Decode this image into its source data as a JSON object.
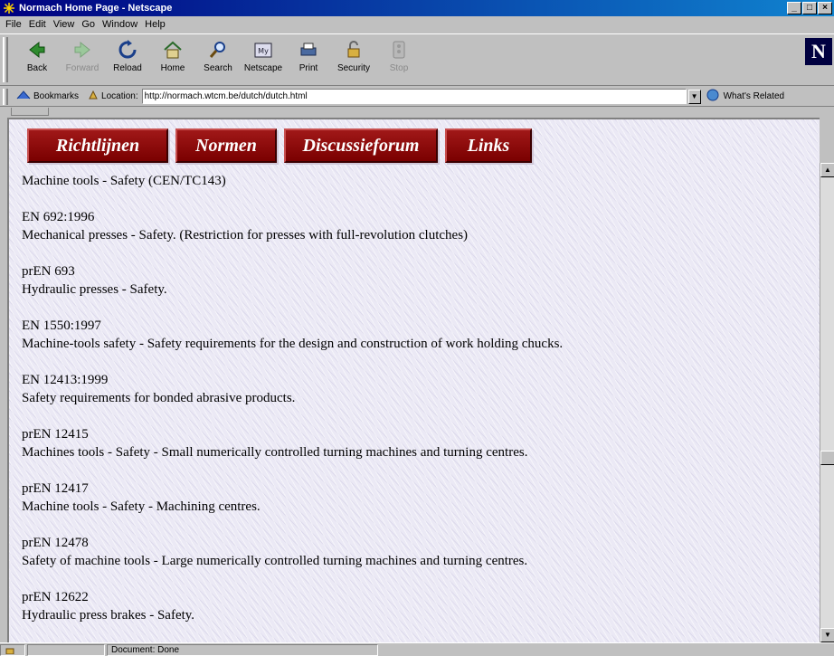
{
  "window": {
    "title": "Normach Home Page - Netscape"
  },
  "menu": [
    "File",
    "Edit",
    "View",
    "Go",
    "Window",
    "Help"
  ],
  "toolbar": [
    {
      "label": "Back",
      "icon": "back-arrow-icon",
      "enabled": true
    },
    {
      "label": "Forward",
      "icon": "forward-arrow-icon",
      "enabled": false
    },
    {
      "label": "Reload",
      "icon": "reload-icon",
      "enabled": true
    },
    {
      "label": "Home",
      "icon": "home-icon",
      "enabled": true
    },
    {
      "label": "Search",
      "icon": "search-icon",
      "enabled": true
    },
    {
      "label": "Netscape",
      "icon": "netscape-icon",
      "enabled": true
    },
    {
      "label": "Print",
      "icon": "print-icon",
      "enabled": true
    },
    {
      "label": "Security",
      "icon": "lock-icon",
      "enabled": true
    },
    {
      "label": "Stop",
      "icon": "stop-icon",
      "enabled": false
    }
  ],
  "location": {
    "bookmarks_label": "Bookmarks",
    "label": "Location:",
    "url": "http://normach.wtcm.be/dutch/dutch.html",
    "related_label": "What's Related"
  },
  "nav": [
    "Richtlijnen",
    "Normen",
    "Discussieforum",
    "Links"
  ],
  "page": {
    "heading": "Machine tools - Safety (CEN/TC143)",
    "entries": [
      {
        "code": "EN 692:1996",
        "desc": "Mechanical presses - Safety. (Restriction for presses with full-revolution clutches)"
      },
      {
        "code": "prEN 693",
        "desc": "Hydraulic presses - Safety."
      },
      {
        "code": "EN 1550:1997",
        "desc": "Machine-tools safety - Safety requirements for the design and construction of work holding chucks."
      },
      {
        "code": "EN 12413:1999",
        "desc": "Safety requirements for bonded abrasive products."
      },
      {
        "code": "prEN 12415",
        "desc": "Machines tools - Safety - Small numerically controlled turning machines and turning centres."
      },
      {
        "code": "prEN 12417",
        "desc": "Machine tools - Safety - Machining centres."
      },
      {
        "code": "prEN 12478",
        "desc": "Safety of machine tools - Large numerically controlled turning machines and turning centres."
      },
      {
        "code": "prEN 12622",
        "desc": "Hydraulic press brakes - Safety."
      }
    ]
  },
  "status": {
    "text": "Document: Done"
  },
  "colors": {
    "nav_button": "#8b0a0a",
    "titlebar": "#000080"
  }
}
